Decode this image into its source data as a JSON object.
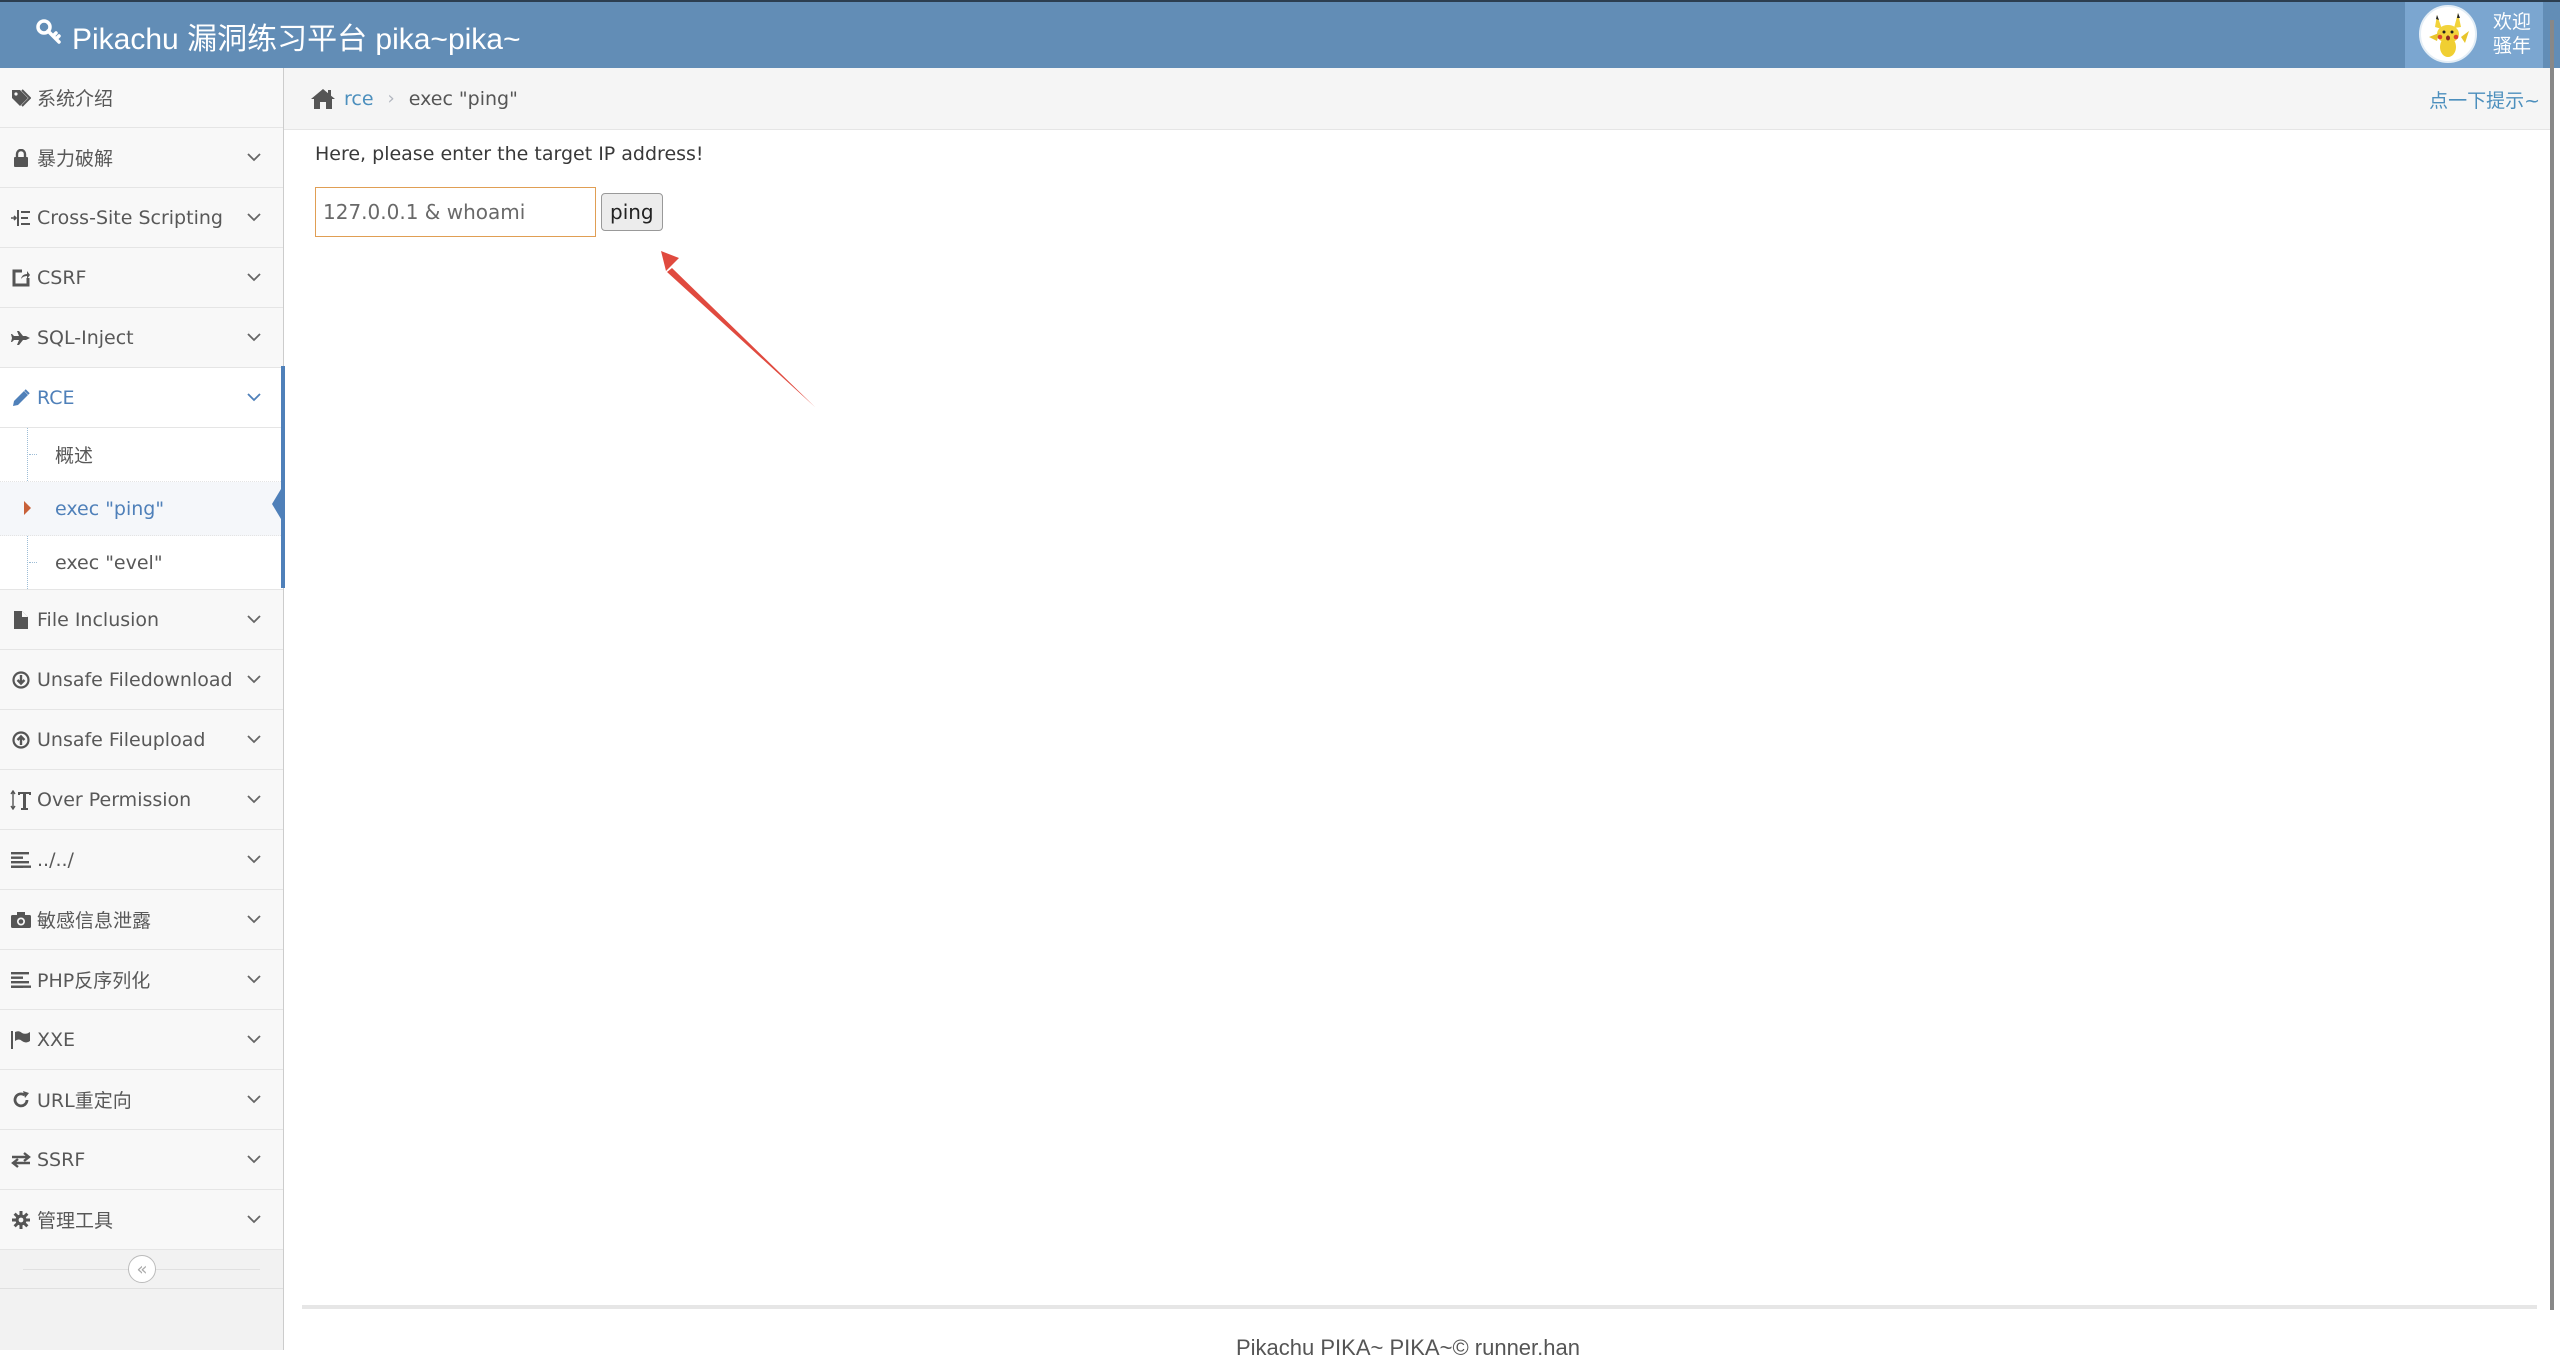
{
  "header": {
    "title": "Pikachu 漏洞练习平台 pika~pika~",
    "logo_icon": "key-icon",
    "user": {
      "avatar": "pikachu-avatar",
      "welcome_line1": "欢迎",
      "welcome_line2": "骚年"
    }
  },
  "sidebar": {
    "items": [
      {
        "label": "系统介绍",
        "icon": "tag-icon",
        "has_chevron": false
      },
      {
        "label": "暴力破解",
        "icon": "lock-icon",
        "has_chevron": true
      },
      {
        "label": "Cross-Site Scripting",
        "icon": "indent-icon",
        "has_chevron": true
      },
      {
        "label": "CSRF",
        "icon": "share-icon",
        "has_chevron": true
      },
      {
        "label": "SQL-Inject",
        "icon": "plane-icon",
        "has_chevron": true
      },
      {
        "label": "RCE",
        "icon": "pencil-icon",
        "has_chevron": true,
        "active": true,
        "children": [
          {
            "label": "概述"
          },
          {
            "label": "exec \"ping\"",
            "active": true
          },
          {
            "label": "exec \"evel\""
          }
        ]
      },
      {
        "label": "File Inclusion",
        "icon": "file-icon",
        "has_chevron": true
      },
      {
        "label": "Unsafe Filedownload",
        "icon": "download-circle-icon",
        "has_chevron": true
      },
      {
        "label": "Unsafe Fileupload",
        "icon": "upload-circle-icon",
        "has_chevron": true
      },
      {
        "label": "Over Permission",
        "icon": "text-height-icon",
        "has_chevron": true
      },
      {
        "label": "../../",
        "icon": "align-left-icon",
        "has_chevron": true
      },
      {
        "label": "敏感信息泄露",
        "icon": "camera-icon",
        "has_chevron": true
      },
      {
        "label": "PHP反序列化",
        "icon": "align-left-icon",
        "has_chevron": true
      },
      {
        "label": "XXE",
        "icon": "flag-icon",
        "has_chevron": true
      },
      {
        "label": "URL重定向",
        "icon": "refresh-icon",
        "has_chevron": true
      },
      {
        "label": "SSRF",
        "icon": "exchange-icon",
        "has_chevron": true
      },
      {
        "label": "管理工具",
        "icon": "cog-icon",
        "has_chevron": true
      }
    ],
    "collapse_label": "«"
  },
  "breadcrumb": {
    "home_icon": "home-icon",
    "parent": "rce",
    "separator": "›",
    "current": "exec \"ping\"",
    "hint": "点一下提示~"
  },
  "main": {
    "prompt": "Here, please enter the target IP address!",
    "ip_input_value": "127.0.0.1 & whoami",
    "submit_label": "ping",
    "annotation": "red-arrow-pointing-to-input"
  },
  "footer": {
    "text": "Pikachu PIKA~ PIKA~© runner.han"
  },
  "colors": {
    "header_bg": "#628db6",
    "accent": "#4f80b9",
    "link": "#4c8fbd",
    "input_border": "#e09e54",
    "arrow": "#e04a3f"
  }
}
